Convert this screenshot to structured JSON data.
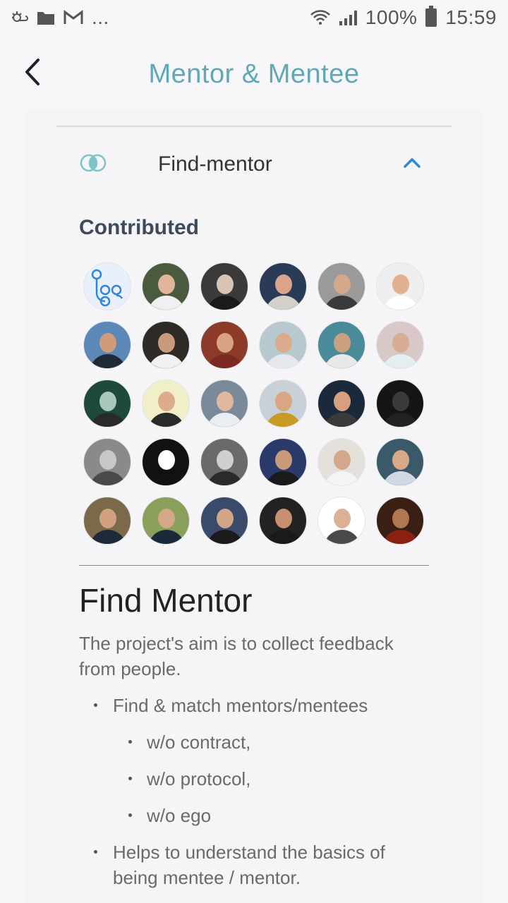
{
  "status_bar": {
    "battery": "100%",
    "time": "15:59",
    "more": "..."
  },
  "header": {
    "title": "Mentor & Mentee"
  },
  "accordion": {
    "title": "Find-mentor"
  },
  "contributed": {
    "label": "Contributed",
    "avatars": [
      {
        "bg": "#e9f0fb",
        "face": "#2f86d8",
        "body": "#2f86d8"
      },
      {
        "bg": "#4a5a3e",
        "face": "#e0b59a",
        "body": "#f0f0f0"
      },
      {
        "bg": "#3a3a3a",
        "face": "#d8c4b4",
        "body": "#1a1a1a"
      },
      {
        "bg": "#2a3b58",
        "face": "#d9a48a",
        "body": "#d4cfc8"
      },
      {
        "bg": "#9a9a9a",
        "face": "#d4a989",
        "body": "#3a3a3a"
      },
      {
        "bg": "#efefef",
        "face": "#e0b090",
        "body": "#ffffff"
      },
      {
        "bg": "#5c88b8",
        "face": "#cf9c7a",
        "body": "#1e2a36"
      },
      {
        "bg": "#2e2a26",
        "face": "#c99b7c",
        "body": "#f1f1f1"
      },
      {
        "bg": "#8c3a2a",
        "face": "#d9a283",
        "body": "#7a2a20"
      },
      {
        "bg": "#b8c8cf",
        "face": "#dbab8d",
        "body": "#e4e8ec"
      },
      {
        "bg": "#4a8b9a",
        "face": "#caa080",
        "body": "#e8e8e8"
      },
      {
        "bg": "#d8c8c8",
        "face": "#d6ac92",
        "body": "#e4eef0"
      },
      {
        "bg": "#1e4a3c",
        "face": "#a8c8b8",
        "body": "#2a2a2a"
      },
      {
        "bg": "#f0efc8",
        "face": "#dcac8c",
        "body": "#2a2a2a"
      },
      {
        "bg": "#7a8a9a",
        "face": "#e0b8a0",
        "body": "#e8eef4"
      },
      {
        "bg": "#c8d0d8",
        "face": "#d9a584",
        "body": "#c79b24"
      },
      {
        "bg": "#1a2a3a",
        "face": "#d6a080",
        "body": "#3a3a3a"
      },
      {
        "bg": "#151515",
        "face": "#3a3a3a",
        "body": "#222222"
      },
      {
        "bg": "#8a8a8a",
        "face": "#c8c8c8",
        "body": "#4a4a4a"
      },
      {
        "bg": "#111111",
        "face": "#ffffff",
        "body": "#111111"
      },
      {
        "bg": "#6a6a6a",
        "face": "#cfcfcf",
        "body": "#2a2a2a"
      },
      {
        "bg": "#2a3a6a",
        "face": "#c89a7a",
        "body": "#1a1a1a"
      },
      {
        "bg": "#e4e0dc",
        "face": "#d4a88a",
        "body": "#f4f4f4"
      },
      {
        "bg": "#3a5a6a",
        "face": "#d8a888",
        "body": "#cfd8e4"
      },
      {
        "bg": "#7a6a4a",
        "face": "#d0a080",
        "body": "#1e2a3a"
      },
      {
        "bg": "#8aa05a",
        "face": "#d4a888",
        "body": "#1a2a3a"
      },
      {
        "bg": "#3a4a6a",
        "face": "#d4a688",
        "body": "#1a1a1a"
      },
      {
        "bg": "#222222",
        "face": "#c89070",
        "body": "#1a1a1a"
      },
      {
        "bg": "#ffffff",
        "face": "#dcb094",
        "body": "#4a4a4a"
      },
      {
        "bg": "#3a2014",
        "face": "#b07850",
        "body": "#8a2010"
      }
    ]
  },
  "document": {
    "title": "Find Mentor",
    "intro": "The project's aim is to collect feedback from people.",
    "bullet1": "Find & match mentors/mentees",
    "sub1": "w/o contract,",
    "sub2": "w/o protocol,",
    "sub3": "w/o ego",
    "bullet2_line1": "Helps to understand the basics of",
    "bullet2_line2": "being mentee / mentor."
  },
  "colors": {
    "accent": "#5fa8b8",
    "chevron": "#2f86d8",
    "section_label": "#3d4a5c"
  },
  "icons": [
    "wifi-icon",
    "signal-icon",
    "battery-icon",
    "back-arrow-icon",
    "overlap-circles-icon",
    "chevron-up-icon"
  ]
}
